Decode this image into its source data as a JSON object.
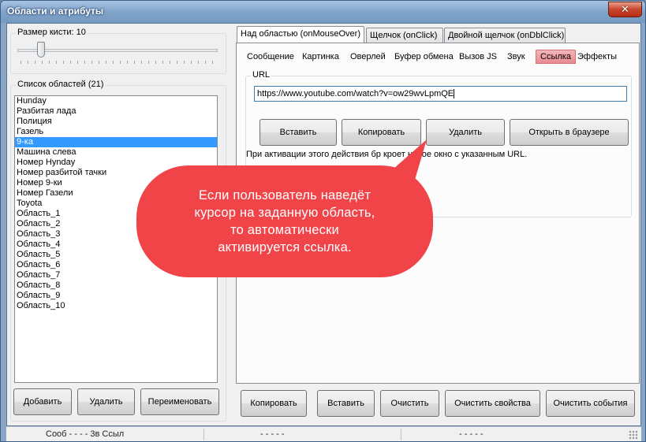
{
  "window": {
    "title": "Области и атрибуты",
    "close_glyph": "✕"
  },
  "brush": {
    "label": "Размер кисти:  10",
    "value": 10
  },
  "areas": {
    "label": "Список областей (21)",
    "items": [
      "Hunday",
      "Разбитая лада",
      "Полиция",
      "Газель",
      "9-ка",
      "Машина слева",
      "Номер Hynday",
      "Номер разбитой тачки",
      "Номер 9-ки",
      "Номер Газели",
      "Toyota",
      "Область_1",
      "Область_2",
      "Область_3",
      "Область_4",
      "Область_5",
      "Область_6",
      "Область_7",
      "Область_8",
      "Область_9",
      "Область_10"
    ],
    "selected_index": 4
  },
  "left_buttons": {
    "add": "Добавить",
    "delete": "Удалить",
    "rename": "Переименовать"
  },
  "event_tabs": [
    "Над областью (onMouseOver)",
    "Щелчок (onClick)",
    "Двойной щелчок (onDblClick)"
  ],
  "action_tabs": [
    "Сообщение",
    "Картинка",
    "Оверлей",
    "Буфер обмена",
    "Вызов JS",
    "Звук",
    "Ссылка",
    "Эффекты"
  ],
  "url_group": {
    "label": "URL",
    "value": "https://www.youtube.com/watch?v=ow29wvLpmQE"
  },
  "url_buttons": {
    "paste": "Вставить",
    "copy": "Копировать",
    "delete": "Удалить",
    "open": "Открыть в браузере"
  },
  "info_text": "При активации этого действия бр                 кроет новое окно с указанным URL.",
  "callout": {
    "text_lines": [
      "Если пользователь наведёт",
      "курсор на заданную область,",
      "то автоматически",
      "активируется ссылка."
    ],
    "color": "#f04449"
  },
  "bottom_buttons": {
    "copy": "Копировать",
    "paste": "Вставить",
    "clear": "Очистить",
    "clear_props": "Очистить свойства",
    "clear_events": "Очистить события"
  },
  "status": {
    "seg1": "Сооб    -    -   -   -  3в Ссыл",
    "seg2": "-   -   -   -   -",
    "seg3": "-   -   -   -   -"
  }
}
